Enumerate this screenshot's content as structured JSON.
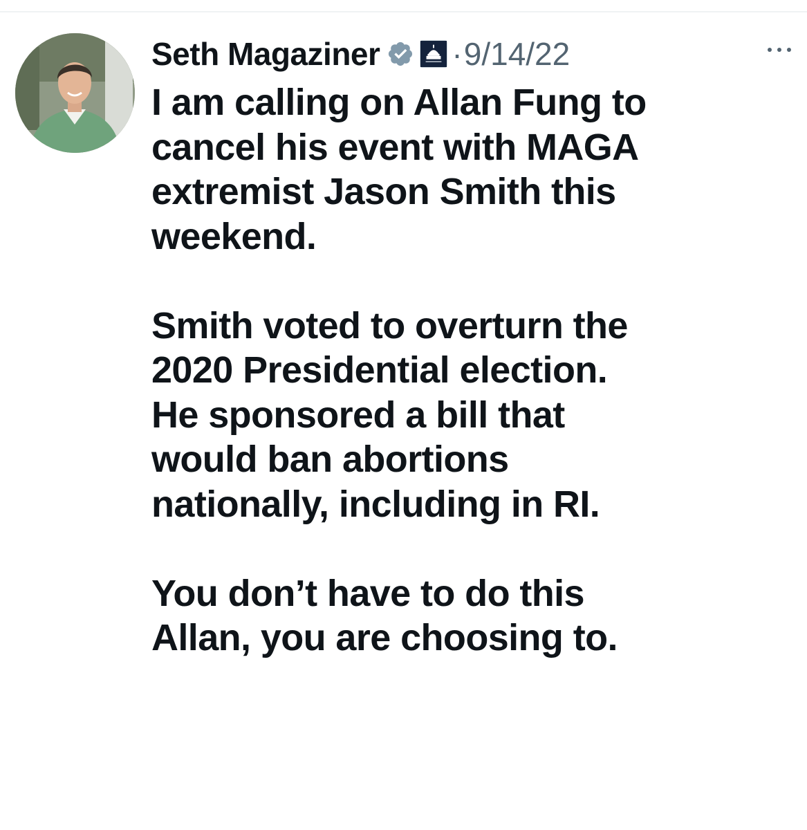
{
  "tweet": {
    "author_name": "Seth Magaziner",
    "separator": "·",
    "date": "9/14/22",
    "text": "I am calling on Allan Fung to\ncancel his event with MAGA\nextremist Jason Smith this\nweekend.\n\nSmith voted to overturn the\n2020 Presidential election.\nHe sponsored a bill that\nwould ban abortions\nnationally, including in RI.\n\nYou don’t have to do this\nAllan, you are choosing to."
  },
  "icons": {
    "verified": "verified-badge-icon",
    "affiliation": "house-democrats-affiliation-icon",
    "more": "more-options-icon",
    "avatar": "profile-avatar"
  },
  "colors": {
    "text_primary": "#0f1419",
    "text_secondary": "#536471",
    "verified_badge": "#829aab",
    "affiliation_bg": "#14233c"
  }
}
